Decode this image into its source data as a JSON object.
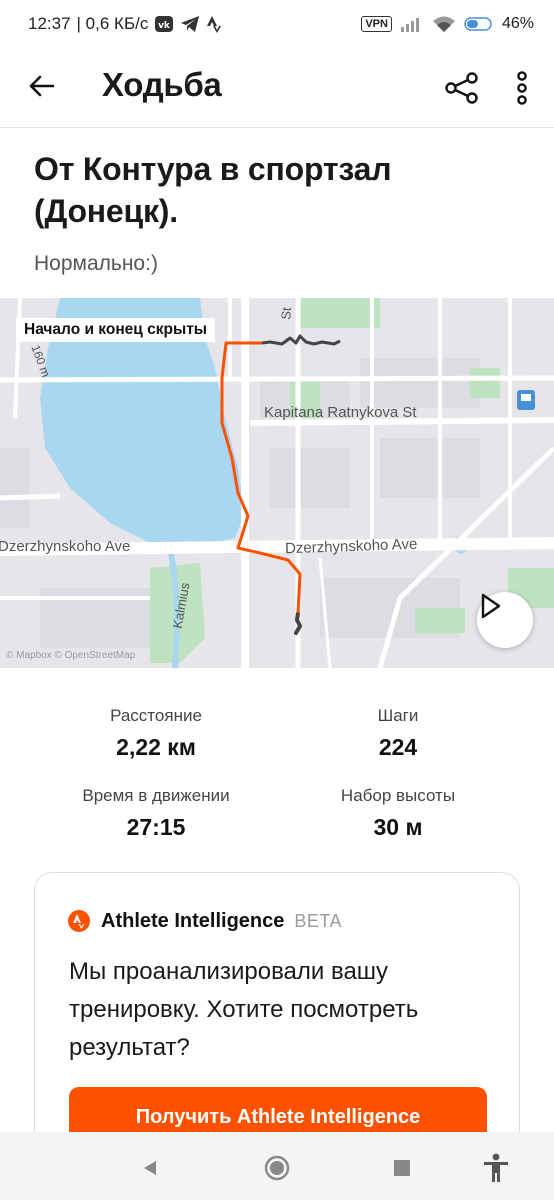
{
  "status_bar": {
    "time": "12:37",
    "network_speed": "| 0,6 КБ/с",
    "vpn": "VPN",
    "battery": "46"
  },
  "app_bar": {
    "title": "Ходьба"
  },
  "activity": {
    "title": "От Контура в спортзал (Донецк).",
    "description": "Нормально:)"
  },
  "map": {
    "hidden_notice": "Начало и конец скрыты",
    "streets": {
      "kapitana": "Kapitana Ratnykova St",
      "dzerzhynskoho_left": "Dzerzhynskoho Ave",
      "dzerzhynskoho_right": "Dzerzhynskoho Ave",
      "kalmius": "Kalmius",
      "st": "St",
      "m160": "160 m"
    },
    "attribution": "© Mapbox © OpenStreetMap",
    "route_color": "#fc5200",
    "hidden_route_color": "#444444",
    "water_color": "#a9d7f0",
    "park_color": "#bfe3c0"
  },
  "stats": {
    "distance_label": "Расстояние",
    "distance_value": "2,22 км",
    "steps_label": "Шаги",
    "steps_value": "224",
    "moving_time_label": "Время в движении",
    "moving_time_value": "27:15",
    "elevation_label": "Набор высоты",
    "elevation_value": "30 м"
  },
  "athlete_intelligence": {
    "name": "Athlete Intelligence",
    "badge": "BETA",
    "message": "Мы проанализировали вашу тренировку. Хотите посмотреть результат?",
    "button_label": "Получить Athlete Intelligence"
  },
  "icons": {
    "back": "arrow-left",
    "share": "share-nodes",
    "more": "vertical-dots",
    "play": "play-triangle",
    "ai_logo": "strava-flame",
    "nav_back": "triangle-left",
    "nav_home": "circle",
    "nav_recents": "square",
    "nav_accessibility": "person"
  }
}
